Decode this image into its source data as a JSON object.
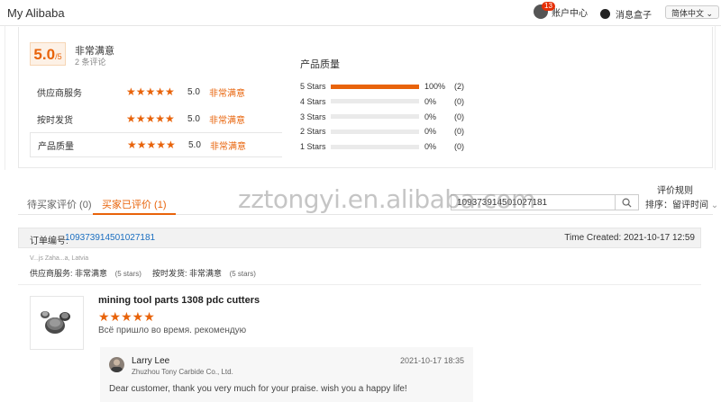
{
  "topbar": {
    "brand": "My Alibaba",
    "account_badge": "13",
    "account_label": "账户中心",
    "messages_label": "消息盒子",
    "language": "简体中文"
  },
  "summary": {
    "overall_score": "5.0",
    "overall_max": "/5",
    "overall_title": "非常满意",
    "review_count": "2 条评论",
    "ratings": [
      {
        "label": "供应商服务",
        "stars": "★★★★★",
        "value": "5.0",
        "desc": "非常满意"
      },
      {
        "label": "按时发货",
        "stars": "★★★★★",
        "value": "5.0",
        "desc": "非常满意"
      },
      {
        "label": "产品质量",
        "stars": "★★★★★",
        "value": "5.0",
        "desc": "非常满意"
      }
    ],
    "quality_title": "产品质量",
    "distribution": [
      {
        "label": "5 Stars",
        "fraction": 1.0,
        "pct": "100%",
        "count": "(2)"
      },
      {
        "label": "4 Stars",
        "fraction": 0,
        "pct": "0%",
        "count": "(0)"
      },
      {
        "label": "3 Stars",
        "fraction": 0,
        "pct": "0%",
        "count": "(0)"
      },
      {
        "label": "2 Stars",
        "fraction": 0,
        "pct": "0%",
        "count": "(0)"
      },
      {
        "label": "1 Stars",
        "fraction": 0,
        "pct": "0%",
        "count": "(0)"
      }
    ],
    "accent_color": "#e8630a"
  },
  "controls": {
    "rules_link": "评价规则",
    "tab_pending": "待买家评价 (0)",
    "tab_reviewed": "买家已评价 (1)",
    "search_value": "109373914501027181",
    "sort_label": "排序：留评时间"
  },
  "order": {
    "label": "订单编号:",
    "number": "109373914501027181",
    "time": "Time Created: 2021-10-17 12:59",
    "buyer": "V...js Zaha...a, Latvia",
    "service_label": "供应商服务:",
    "service_value": "非常满意",
    "service_stars": "(5 stars)",
    "shipping_label": "按时发货:",
    "shipping_value": "非常满意",
    "shipping_stars": "(5 stars)"
  },
  "review": {
    "product": "mining tool parts 1308 pdc cutters",
    "stars": "★★★★★",
    "text": "Всё пришло во время. рекомендую"
  },
  "reply": {
    "name": "Larry Lee",
    "company": "Zhuzhou Tony Carbide Co., Ltd.",
    "date": "2021-10-17 18:35",
    "text": "Dear customer, thank you very much for your praise. wish you a happy life!"
  },
  "watermark": "zztongyi.en.alibaba.com"
}
